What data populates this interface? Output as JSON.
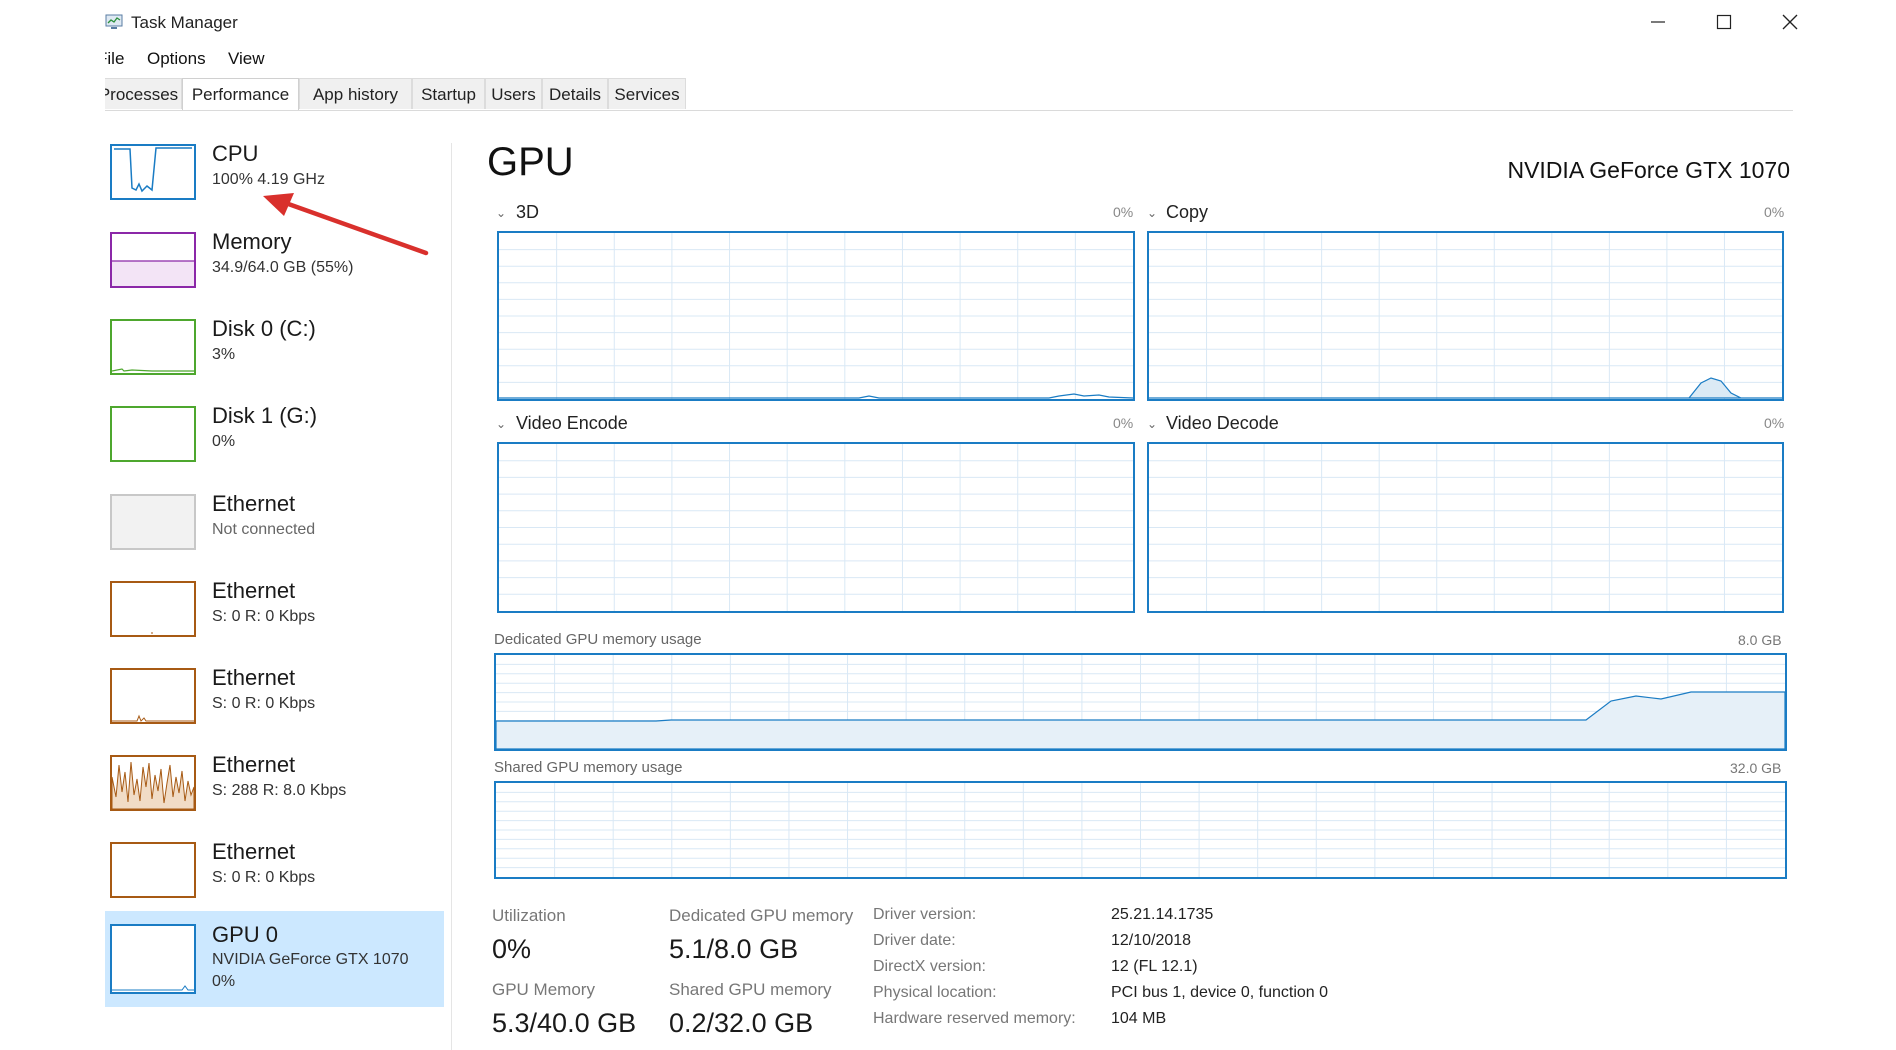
{
  "window": {
    "title": "Task Manager",
    "minimize_icon": "minimize-icon",
    "maximize_icon": "maximize-icon",
    "close_icon": "close-icon"
  },
  "menu": [
    "File",
    "Options",
    "View"
  ],
  "tabs": [
    "Processes",
    "Performance",
    "App history",
    "Startup",
    "Users",
    "Details",
    "Services"
  ],
  "active_tab": "Performance",
  "sidebar": {
    "items": [
      {
        "title": "CPU",
        "subtitle": "100%  4.19 GHz",
        "color": "#1a7cc4"
      },
      {
        "title": "Memory",
        "subtitle": "34.9/64.0 GB (55%)",
        "color": "#8b28a8"
      },
      {
        "title": "Disk 0 (C:)",
        "subtitle": "3%",
        "color": "#4ea72e"
      },
      {
        "title": "Disk 1 (G:)",
        "subtitle": "0%",
        "color": "#4ea72e"
      },
      {
        "title": "Ethernet",
        "subtitle": "Not connected",
        "color": "#aaaaaa"
      },
      {
        "title": "Ethernet",
        "subtitle": "S: 0 R: 0 Kbps",
        "color": "#a75a14"
      },
      {
        "title": "Ethernet",
        "subtitle": "S: 0 R: 0 Kbps",
        "color": "#a75a14"
      },
      {
        "title": "Ethernet",
        "subtitle": "S: 288 R: 8.0 Kbps",
        "color": "#a75a14"
      },
      {
        "title": "Ethernet",
        "subtitle": "S: 0 R: 0 Kbps",
        "color": "#a75a14"
      },
      {
        "title": "GPU 0",
        "subtitle": "NVIDIA GeForce GTX 1070",
        "subtitle2": "0%",
        "color": "#1a7cc4"
      }
    ]
  },
  "main": {
    "title": "GPU",
    "gpu_name": "NVIDIA GeForce GTX 1070",
    "engines": [
      {
        "label": "3D",
        "percent": "0%"
      },
      {
        "label": "Copy",
        "percent": "0%"
      },
      {
        "label": "Video Encode",
        "percent": "0%"
      },
      {
        "label": "Video Decode",
        "percent": "0%"
      }
    ],
    "dedicated_memory": {
      "label": "Dedicated GPU memory usage",
      "max": "8.0 GB"
    },
    "shared_memory": {
      "label": "Shared GPU memory usage",
      "max": "32.0 GB"
    },
    "stats": {
      "utilization_label": "Utilization",
      "utilization_value": "0%",
      "dedicated_label": "Dedicated GPU memory",
      "dedicated_value": "5.1/8.0 GB",
      "gpu_memory_label": "GPU Memory",
      "gpu_memory_value": "5.3/40.0 GB",
      "shared_label": "Shared GPU memory",
      "shared_value": "0.2/32.0 GB"
    },
    "info": [
      {
        "label": "Driver version:",
        "value": "25.21.14.1735"
      },
      {
        "label": "Driver date:",
        "value": "12/10/2018"
      },
      {
        "label": "DirectX version:",
        "value": "12 (FL 12.1)"
      },
      {
        "label": "Physical location:",
        "value": "PCI bus 1, device 0, function 0"
      },
      {
        "label": "Hardware reserved memory:",
        "value": "104 MB"
      }
    ]
  },
  "annotation": {
    "arrow_color": "#d9302c"
  }
}
